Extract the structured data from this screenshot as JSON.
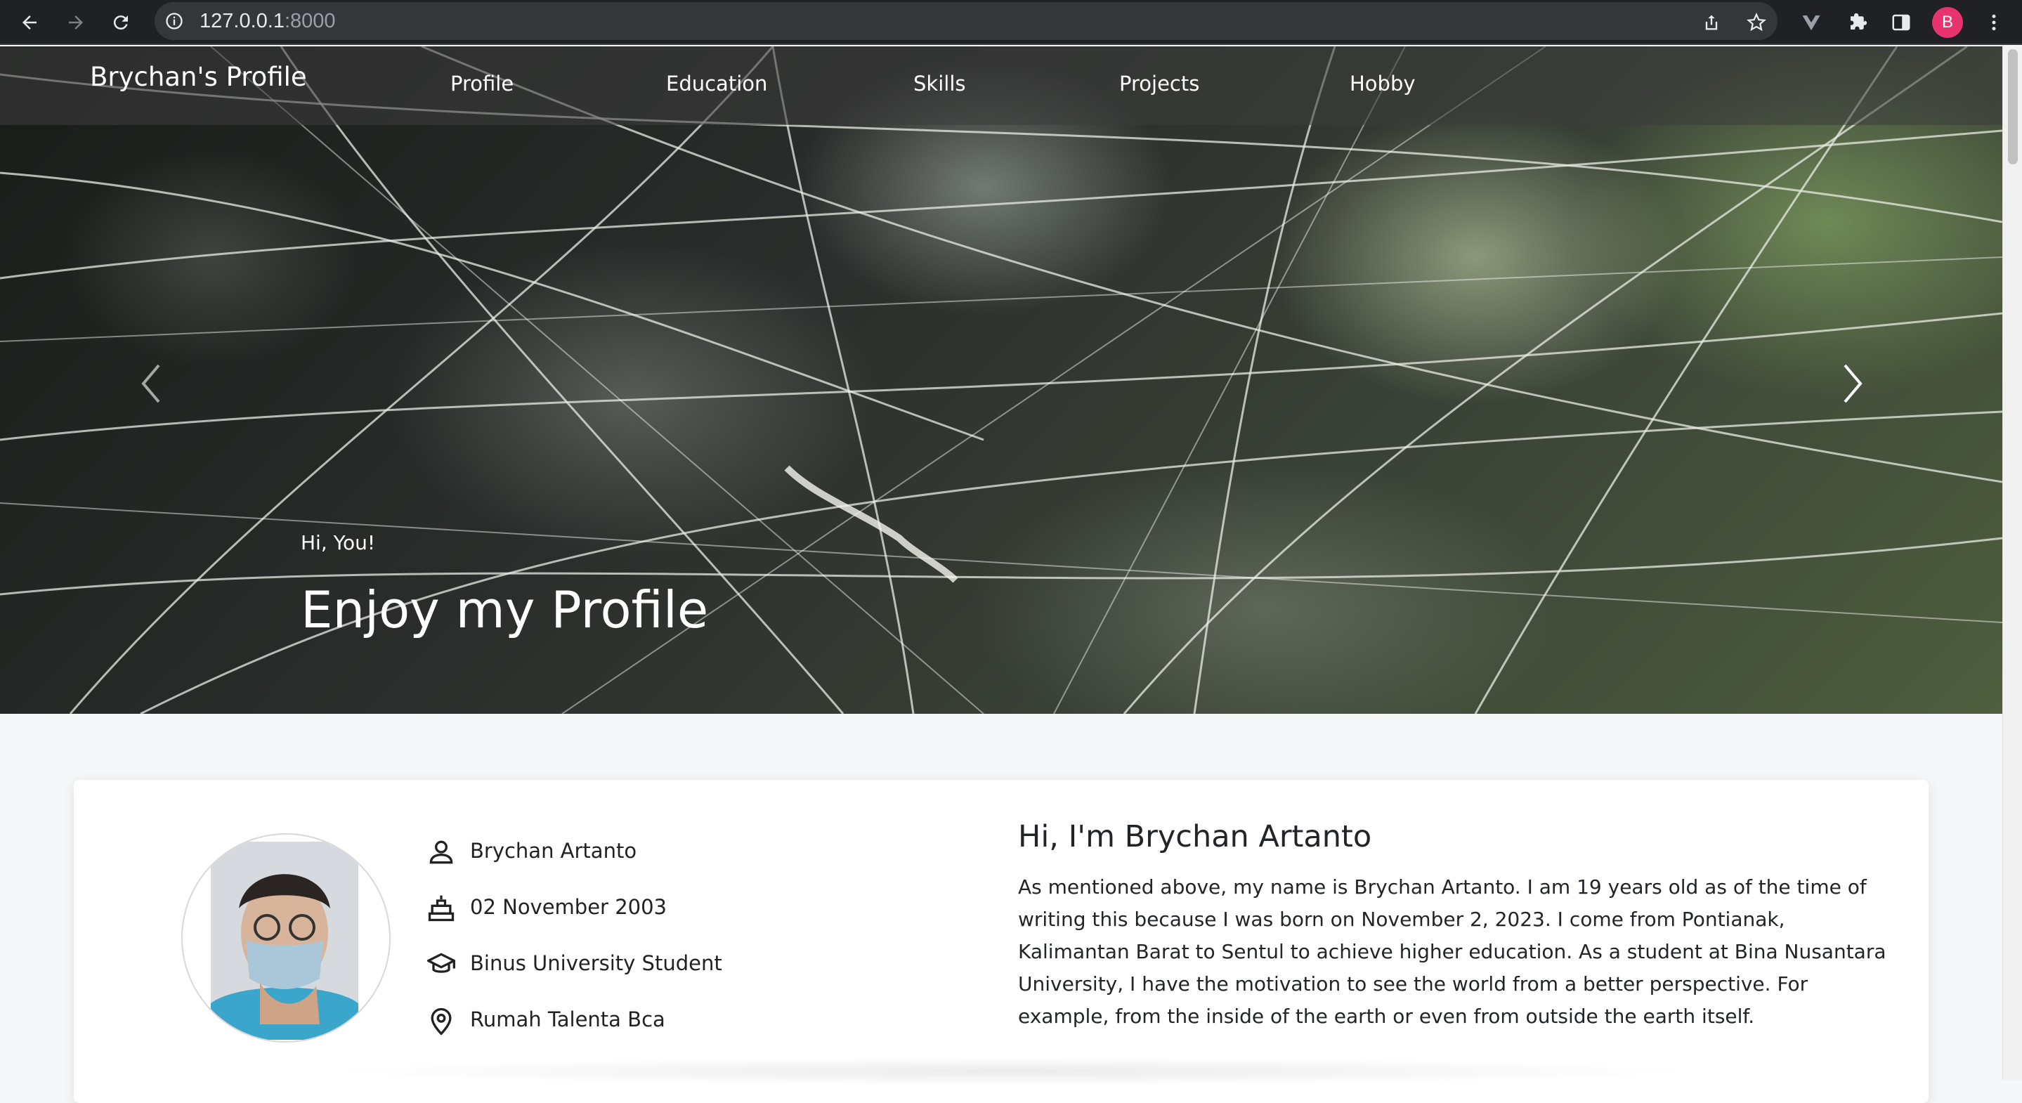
{
  "browser": {
    "url_host": "127.0.0.1",
    "url_port": ":8000",
    "profile_initial": "B",
    "avatar_color": "#e8336e"
  },
  "navbar": {
    "brand": "Brychan's Profile",
    "items": [
      "Profile",
      "Education",
      "Skills",
      "Projects",
      "Hobby"
    ]
  },
  "hero": {
    "subtitle": "Hi, You!",
    "title": "Enjoy my Profile"
  },
  "profile": {
    "name": "Brychan Artanto",
    "birthdate": "02 November 2003",
    "status": "Binus University Student",
    "location": "Rumah Talenta Bca",
    "icons": [
      "person-icon",
      "cake-icon",
      "graduation-cap-icon",
      "location-pin-icon"
    ]
  },
  "about": {
    "title": "Hi, I'm Brychan Artanto",
    "body": "As mentioned above, my name is Brychan Artanto. I am 19 years old as of the time of writing this because I was born on November 2, 2023. I come from Pontianak, Kalimantan Barat to Sentul to achieve higher education. As a student at Bina Nusantara University, I have the motivation to see the world from a better perspective. For example, from the inside of the earth or even from outside the earth itself."
  }
}
